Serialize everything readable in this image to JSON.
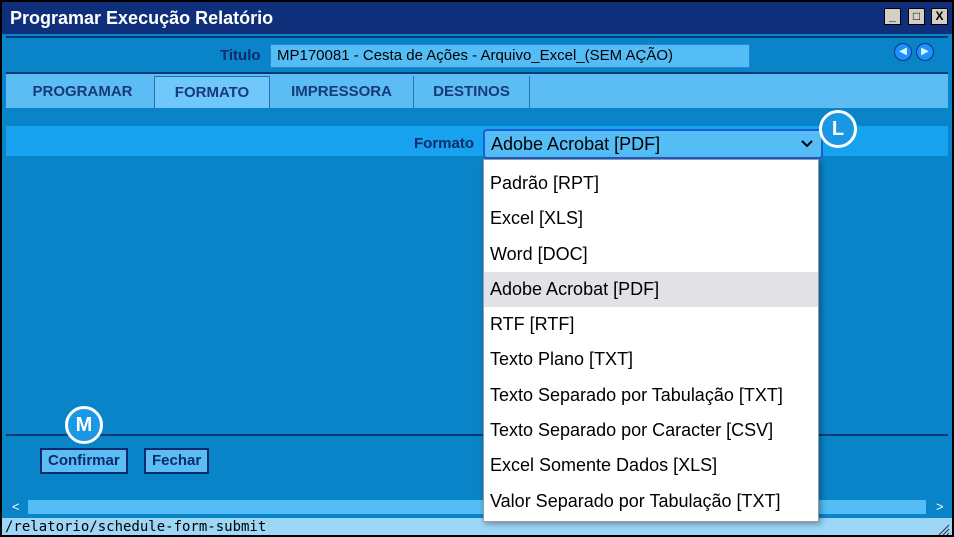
{
  "window": {
    "title": "Programar Execução Relatório",
    "controls": [
      "_",
      "□",
      "X"
    ]
  },
  "header": {
    "title_label": "Titulo",
    "title_value": "MP170081 - Cesta de Ações - Arquivo_Excel_(SEM AÇÃO)",
    "nav_prev": "◀",
    "nav_next": "▶"
  },
  "tabs": [
    {
      "label": "PROGRAMAR",
      "active": false
    },
    {
      "label": "FORMATO",
      "active": true
    },
    {
      "label": "IMPRESSORA",
      "active": false
    },
    {
      "label": "DESTINOS",
      "active": false
    }
  ],
  "format": {
    "label": "Formato",
    "selected": "Adobe Acrobat [PDF]",
    "options": [
      "Padrão [RPT]",
      "Excel [XLS]",
      "Word [DOC]",
      "Adobe Acrobat [PDF]",
      "RTF [RTF]",
      "Texto Plano [TXT]",
      "Texto Separado por Tabulação [TXT]",
      "Texto Separado por Caracter [CSV]",
      "Excel Somente Dados [XLS]",
      "Valor Separado por Tabulação [TXT]"
    ]
  },
  "badges": {
    "l": "L",
    "m": "M"
  },
  "buttons": {
    "confirm": "Confirmar",
    "close": "Fechar"
  },
  "scroll": {
    "left": "<",
    "right": ">"
  },
  "status": {
    "text": "/relatorio/schedule-form-submit"
  },
  "colors": {
    "titlebar": "#0f2f7a",
    "body": "#0a84c8",
    "accent": "#55bdf6"
  }
}
